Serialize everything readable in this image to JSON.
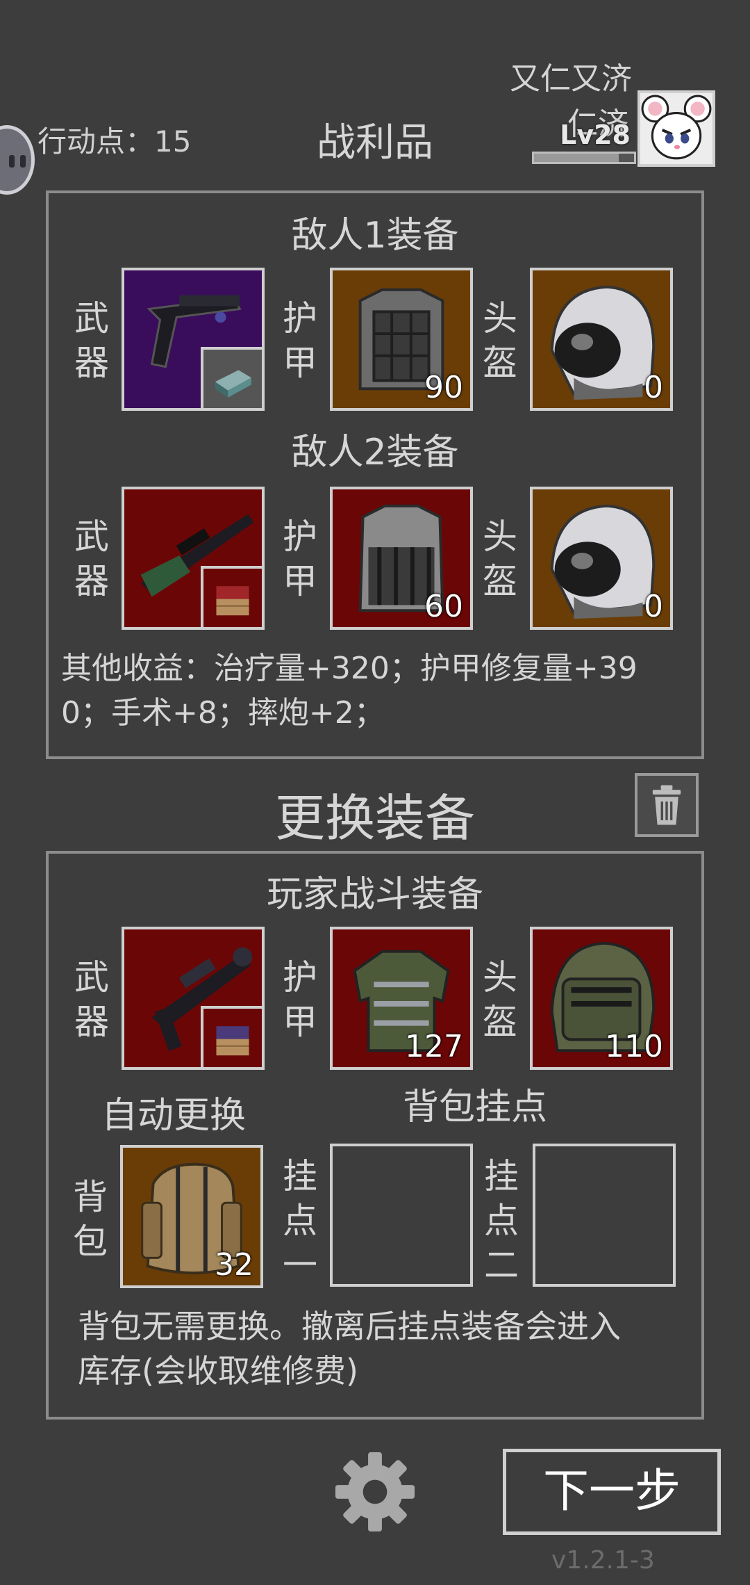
{
  "topbar": {
    "action_points": "行动点：15",
    "title": "战利品",
    "player_name_line1": "又仁又济",
    "player_name_line2": "仁济",
    "level": "Lv28",
    "xp_fraction": 0.85
  },
  "loot": {
    "enemy1_heading": "敌人1装备",
    "enemy2_heading": "敌人2装备",
    "labels": {
      "weapon": [
        "武",
        "器"
      ],
      "armor": [
        "护",
        "甲"
      ],
      "helmet": [
        "头",
        "盔"
      ]
    },
    "enemy1": {
      "armor_durability": "90",
      "helmet_durability": "0"
    },
    "enemy2": {
      "armor_durability": "60",
      "helmet_durability": "0"
    },
    "other_income_line1": "其他收益：治疗量+320；护甲修复量+39",
    "other_income_line2": "0；手术+8；摔炮+2；"
  },
  "swap": {
    "title": "更换装备",
    "trash_icon": "trash-icon"
  },
  "player": {
    "heading": "玩家战斗装备",
    "armor_durability": "127",
    "helmet_durability": "110",
    "auto_swap_label": "自动更换",
    "backpack_mounts_label": "背包挂点",
    "backpack_label": [
      "背",
      "包"
    ],
    "backpack_value": "32",
    "mount1_label": [
      "挂",
      "点",
      "一"
    ],
    "mount2_label": [
      "挂",
      "点",
      "二"
    ],
    "note_line1": "背包无需更换。撤离后挂点装备会进入",
    "note_line2": "库存(会收取维修费)"
  },
  "footer": {
    "next_button": "下一步",
    "version": "v1.2.1-3"
  },
  "colors": {
    "background": "#3d3d3d",
    "rarity_purple": "#3a0d5c",
    "rarity_gold": "#6a3d07",
    "rarity_red": "#6b0606"
  }
}
